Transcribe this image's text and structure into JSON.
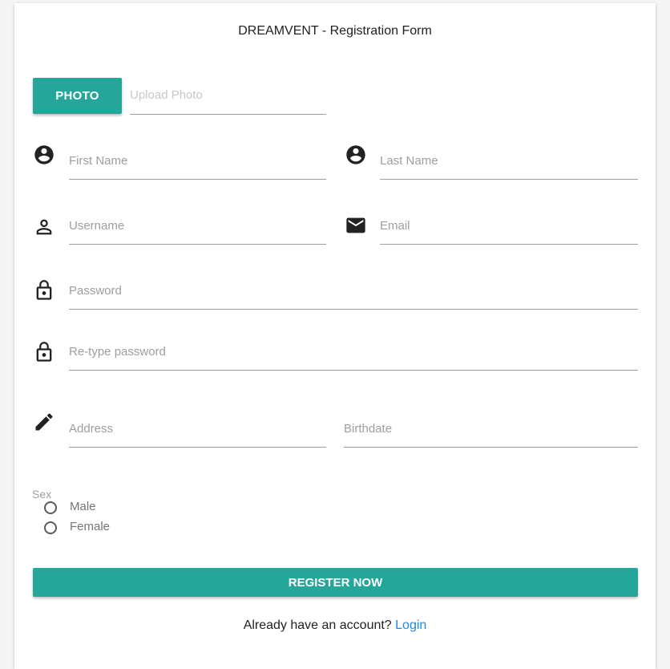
{
  "form": {
    "title": "DREAMVENT - Registration Form",
    "photo_button": "PHOTO",
    "upload_placeholder": "Upload Photo",
    "first_name_placeholder": "First Name",
    "last_name_placeholder": "Last Name",
    "username_placeholder": "Username",
    "email_placeholder": "Email",
    "password_placeholder": "Password",
    "retype_password_placeholder": "Re-type password",
    "address_placeholder": "Address",
    "birthdate_placeholder": "Birthdate",
    "sex_label": "Sex",
    "sex_options": [
      "Male",
      "Female"
    ],
    "register_button": "REGISTER NOW",
    "login_prompt": "Already have an account?",
    "login_link": "Login"
  },
  "icons": {
    "first_name": "account-circle-icon",
    "last_name": "account-circle-icon",
    "username": "person-outline-icon",
    "email": "email-icon",
    "password": "lock-icon",
    "retype_password": "lock-icon",
    "address": "pencil-icon"
  },
  "colors": {
    "accent": "#26a69a",
    "link": "#1e88e5",
    "underline": "#9e9e9e"
  }
}
